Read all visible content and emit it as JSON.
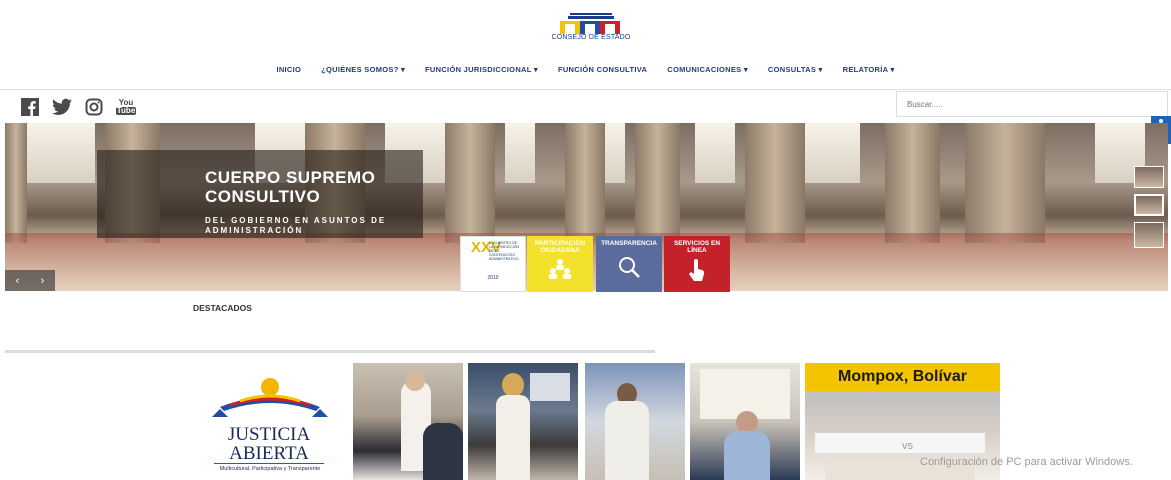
{
  "header": {
    "logo_text": "CONSEJO DE ESTADO"
  },
  "nav": {
    "items": [
      "INICIO",
      "¿QUIÉNES SOMOS? ▾",
      "FUNCIÓN JURISDICCIONAL ▾",
      "FUNCIÓN CONSULTIVA",
      "COMUNICACIONES ▾",
      "CONSULTAS ▾",
      "RELATORÍA ▾"
    ]
  },
  "social": {
    "icons": [
      "facebook-icon",
      "twitter-icon",
      "instagram-icon",
      "youtube-icon"
    ],
    "youtube_text_1": "You",
    "youtube_text_2": "Tube"
  },
  "search": {
    "placeholder": "Buscar....."
  },
  "hero": {
    "title_line1": "CUERPO SUPREMO",
    "title_line2": "CONSULTIVO",
    "subtitle": "DEL GOBIERNO EN ASUNTOS DE ADMINISTRACIÓN",
    "prev": "‹",
    "next": "›"
  },
  "tiles": {
    "encuentro_big": "XXV",
    "encuentro_small": "ENCUENTRO DE LA JURISDICCIÓN DE LO CONTENCIOSO ADMINISTRATIVO",
    "encuentro_year": "2019",
    "participacion": "PARTICIPACIÓN CIUDADANA",
    "transparencia": "TRANSPARENCIA",
    "servicios": "SERVICIOS EN LÍNEA"
  },
  "featured": {
    "heading": "DESTACADOS",
    "justicia_line1": "JUSTICIA",
    "justicia_line2": "ABIERTA",
    "justicia_tagline": "Multicultural, Participativa y Transparente",
    "mompox_banner": "Mompox, Bolívar"
  },
  "watermark": {
    "line1": "vs",
    "line2": "Configuración de PC para activar Windows."
  },
  "colors": {
    "nav_text": "#223c7a",
    "participacion": "#f3e12b",
    "transparencia": "#5b6b9b",
    "servicios": "#c3222b",
    "mompox_yellow": "#f5c400",
    "accessibility": "#1f62b6"
  }
}
